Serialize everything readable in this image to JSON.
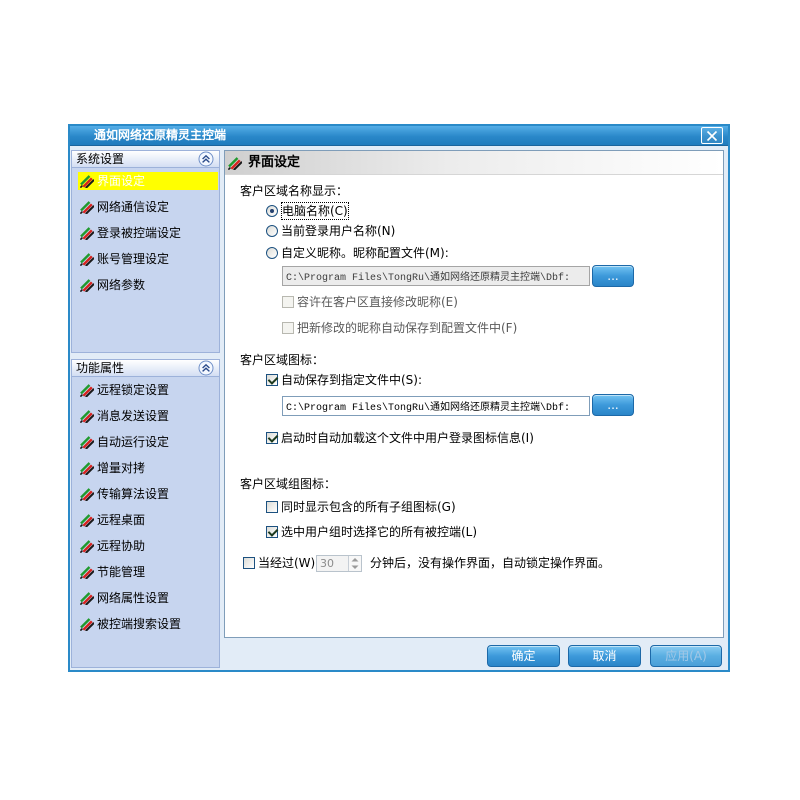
{
  "window": {
    "title": "通如网络还原精灵主控端"
  },
  "icons": {
    "close": "close-icon",
    "collapse": "double-chevron-up-icon",
    "nav_item": "striped-pencil-icon",
    "spinner_up": "arrow-up-icon",
    "spinner_down": "arrow-down-icon"
  },
  "colors": {
    "window_border": "#2a8ac8",
    "title_bar": "#2a88c9",
    "sidebar": "#c7d5ef",
    "selected_item": "#ffff00",
    "button": "#3d99da"
  },
  "sidebar": {
    "panels": [
      {
        "title": "系统设置",
        "items": [
          {
            "label": "界面设定",
            "selected": true
          },
          {
            "label": "网络通信设定",
            "selected": false
          },
          {
            "label": "登录被控端设定",
            "selected": false
          },
          {
            "label": "账号管理设定",
            "selected": false
          },
          {
            "label": "网络参数",
            "selected": false
          }
        ]
      },
      {
        "title": "功能属性",
        "items": [
          {
            "label": "远程锁定设置",
            "selected": false
          },
          {
            "label": "消息发送设置",
            "selected": false
          },
          {
            "label": "自动运行设定",
            "selected": false
          },
          {
            "label": "增量对拷",
            "selected": false
          },
          {
            "label": "传输算法设置",
            "selected": false
          },
          {
            "label": "远程桌面",
            "selected": false
          },
          {
            "label": "远程协助",
            "selected": false
          },
          {
            "label": "节能管理",
            "selected": false
          },
          {
            "label": "网络属性设置",
            "selected": false
          },
          {
            "label": "被控端搜索设置",
            "selected": false
          }
        ]
      }
    ]
  },
  "main": {
    "title": "界面设定",
    "name_display": {
      "label": "客户区域名称显示：",
      "options": [
        {
          "label": "电脑名称(C)",
          "checked": true,
          "focused": true
        },
        {
          "label": "当前登录用户名称(N)",
          "checked": false,
          "focused": false
        },
        {
          "label": "自定义昵称。昵称配置文件(M):",
          "checked": false,
          "focused": false
        }
      ],
      "nickname_file": {
        "value": "C:\\Program Files\\TongRu\\通如网络还原精灵主控端\\Dbf:",
        "disabled": true
      },
      "browse_label": "...",
      "allow_edit": {
        "label": "容许在客户区直接修改昵称(E)",
        "checked": false,
        "disabled": true
      },
      "auto_save_nickname": {
        "label": "把新修改的昵称自动保存到配置文件中(F)",
        "checked": false,
        "disabled": true
      }
    },
    "icons": {
      "label": "客户区域图标：",
      "auto_save": {
        "label": "自动保存到指定文件中(S):",
        "checked": true
      },
      "file": {
        "value": "C:\\Program Files\\TongRu\\通如网络还原精灵主控端\\Dbf:"
      },
      "browse_label": "...",
      "load_on_start": {
        "label": "启动时自动加载这个文件中用户登录图标信息(I)",
        "checked": true
      }
    },
    "group_icons": {
      "label": "客户区域组图标：",
      "show_sub": {
        "label": "同时显示包含的所有子组图标(G)",
        "checked": false
      },
      "select_all": {
        "label": "选中用户组时选择它的所有被控端(L)",
        "checked": true
      }
    },
    "auto_lock": {
      "label": "当经过(W)",
      "checked": false,
      "minutes": "30",
      "suffix": "分钟后，没有操作界面，自动锁定操作界面。"
    }
  },
  "buttons": {
    "ok": "确定",
    "cancel": "取消",
    "apply": "应用(A)",
    "apply_disabled": true
  }
}
